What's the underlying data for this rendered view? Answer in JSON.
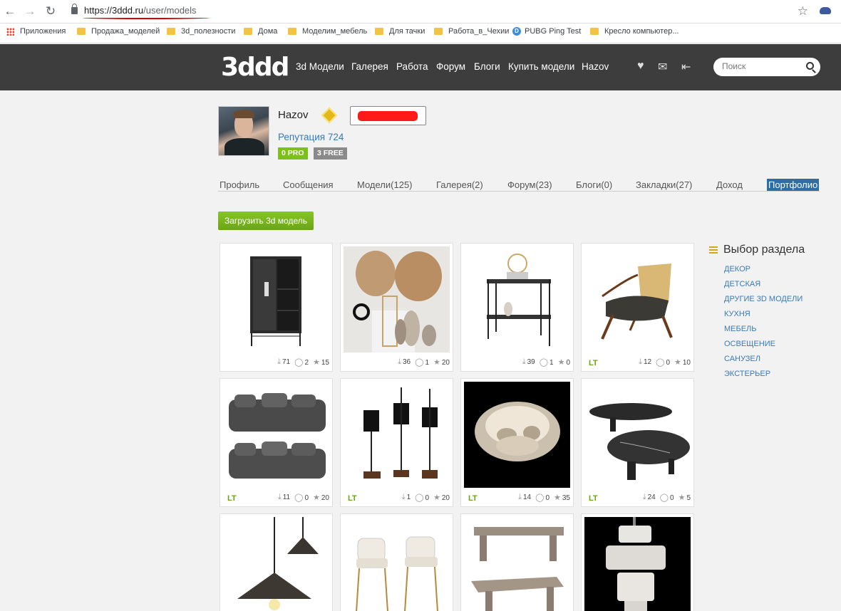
{
  "browser": {
    "url_host": "https://3ddd.ru",
    "url_path": "/user/models",
    "bookmarks": [
      "Приложения",
      "Продажа_моделей",
      "3d_полезности",
      "Дома",
      "Моделим_мебель",
      "Для тачки",
      "Работа_в_Чехии",
      "PUBG Ping Test",
      "Кресло компьютер..."
    ]
  },
  "header": {
    "logo": "3ddd",
    "nav": [
      "3d Модели",
      "Галерея",
      "Работа",
      "Форум",
      "Блоги",
      "Купить модели",
      "Hazov"
    ],
    "search_placeholder": "Поиск"
  },
  "profile": {
    "username": "Hazov",
    "reputation": "Репутация 724",
    "pro_tag": "0 PRO",
    "free_tag": "3 FREE"
  },
  "tabs": [
    "Профиль",
    "Сообщения",
    "Модели(125)",
    "Галерея(2)",
    "Форум(23)",
    "Блоги(0)",
    "Закладки(27)",
    "Доход",
    "Портфолио"
  ],
  "upload_button": "Загрузить 3d модель",
  "models": [
    {
      "name": "cabinet",
      "lt": "",
      "downloads": "71",
      "comments": "2",
      "rating": "15"
    },
    {
      "name": "decor set",
      "lt": "",
      "downloads": "36",
      "comments": "1",
      "rating": "20"
    },
    {
      "name": "serving cart",
      "lt": "",
      "downloads": "39",
      "comments": "1",
      "rating": "0"
    },
    {
      "name": "armchair",
      "lt": "LT",
      "downloads": "12",
      "comments": "0",
      "rating": "10"
    },
    {
      "name": "sofa",
      "lt": "LT",
      "downloads": "11",
      "comments": "0",
      "rating": "20"
    },
    {
      "name": "floor lamps",
      "lt": "LT",
      "downloads": "1",
      "comments": "0",
      "rating": "20"
    },
    {
      "name": "chandelier",
      "lt": "LT",
      "downloads": "14",
      "comments": "0",
      "rating": "35"
    },
    {
      "name": "coffee tables",
      "lt": "LT",
      "downloads": "24",
      "comments": "0",
      "rating": "5"
    }
  ],
  "sections": {
    "title": "Выбор раздела",
    "items": [
      "ДЕКОР",
      "ДЕТСКАЯ",
      "ДРУГИЕ 3D МОДЕЛИ",
      "КУХНЯ",
      "МЕБЕЛЬ",
      "ОСВЕЩЕНИЕ",
      "САНУЗЕЛ",
      "ЭКСТЕРЬЕР"
    ]
  }
}
